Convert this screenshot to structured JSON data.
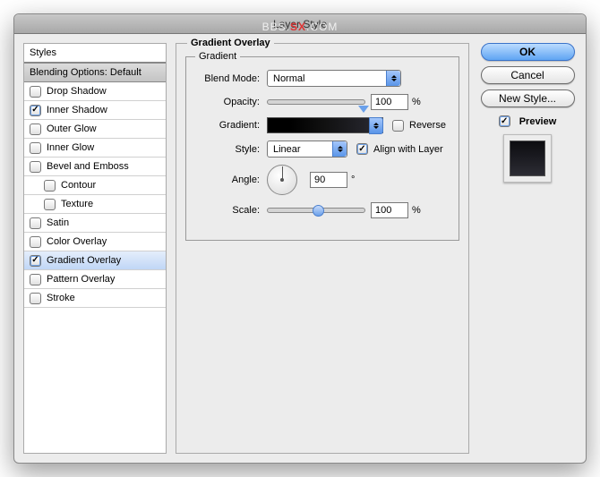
{
  "title": "Layer Style",
  "watermark": {
    "pre": "BBS.",
    "mid": "SX",
    "post": ".COM"
  },
  "styles_header": "Styles",
  "blending_header": "Blending Options: Default",
  "styles": {
    "drop_shadow": "Drop Shadow",
    "inner_shadow": "Inner Shadow",
    "outer_glow": "Outer Glow",
    "inner_glow": "Inner Glow",
    "bevel_emboss": "Bevel and Emboss",
    "contour": "Contour",
    "texture": "Texture",
    "satin": "Satin",
    "color_overlay": "Color Overlay",
    "gradient_overlay": "Gradient Overlay",
    "pattern_overlay": "Pattern Overlay",
    "stroke": "Stroke"
  },
  "group_title": "Gradient Overlay",
  "inner_group_title": "Gradient",
  "form": {
    "blend_mode_label": "Blend Mode:",
    "blend_mode_value": "Normal",
    "opacity_label": "Opacity:",
    "opacity_value": "100",
    "opacity_unit": "%",
    "gradient_label": "Gradient:",
    "reverse_label": "Reverse",
    "style_label": "Style:",
    "style_value": "Linear",
    "align_label": "Align with Layer",
    "angle_label": "Angle:",
    "angle_value": "90",
    "angle_unit": "°",
    "scale_label": "Scale:",
    "scale_value": "100",
    "scale_unit": "%"
  },
  "buttons": {
    "ok": "OK",
    "cancel": "Cancel",
    "new_style": "New Style..."
  },
  "preview_label": "Preview"
}
